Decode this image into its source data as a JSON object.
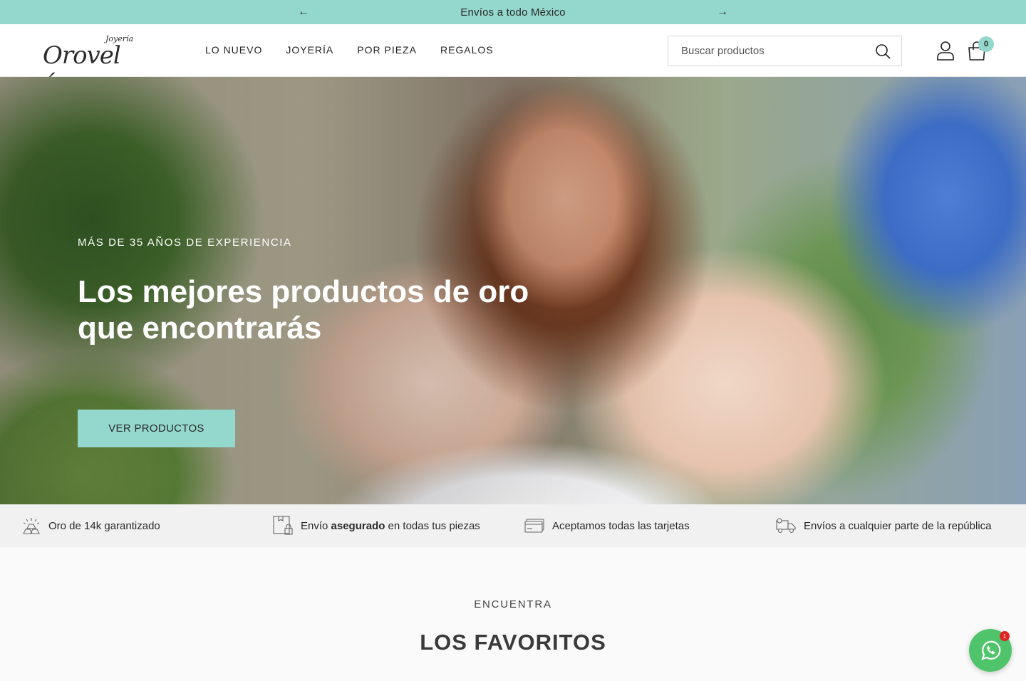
{
  "announcement": {
    "text": "Envíos a todo México",
    "prev_icon": "arrow-left-icon",
    "next_icon": "arrow-right-icon"
  },
  "header": {
    "logo_script": "Orovel´s",
    "logo_small": "Joyería",
    "nav": [
      "LO NUEVO",
      "JOYERÍA",
      "POR PIEZA",
      "REGALOS"
    ],
    "search_placeholder": "Buscar productos",
    "cart_count": "0"
  },
  "hero": {
    "eyebrow": "MÁS DE 35 AÑOS DE EXPERIENCIA",
    "headline": "Los mejores productos de oro que encontrarás",
    "cta_label": "VER PRODUCTOS"
  },
  "features": [
    {
      "icon": "gold-bars-icon",
      "text": "Oro de 14k garantizado"
    },
    {
      "icon": "secure-box-icon",
      "pre": "Envío ",
      "bold": "asegurado",
      "post": " en todas tus piezas"
    },
    {
      "icon": "credit-card-icon",
      "text": "Aceptamos todas las tarjetas"
    },
    {
      "icon": "delivery-truck-icon",
      "text": "Envíos a cualquier parte de la república"
    }
  ],
  "section": {
    "eyebrow": "ENCUENTRA",
    "title": "LOS FAVORITOS"
  },
  "whatsapp": {
    "icon": "whatsapp-icon",
    "badge": "1"
  },
  "colors": {
    "accent": "#94d7cd",
    "whatsapp": "#4fc46a"
  }
}
